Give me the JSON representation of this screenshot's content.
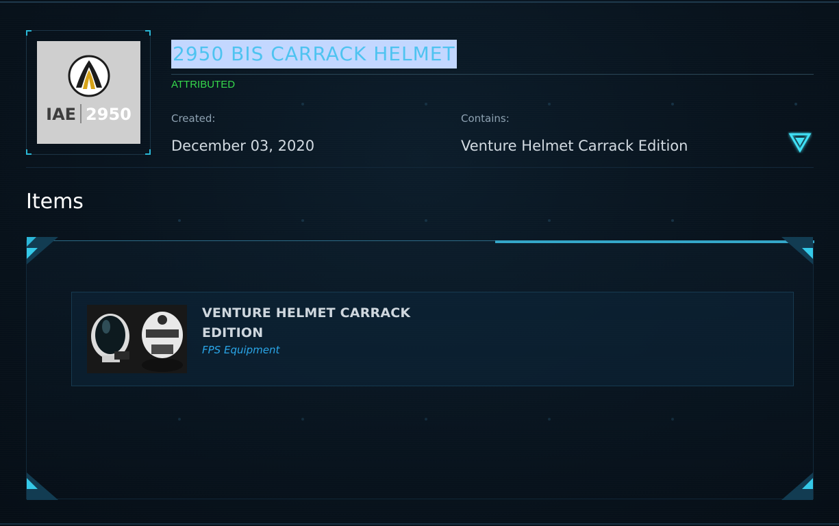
{
  "pledge": {
    "title": "2950 BIS CARRACK HELMET",
    "status": "ATTRIBUTED",
    "thumbnail": {
      "logo_text": "IAE",
      "logo_year": "2950",
      "icon": "iae-emblem-icon"
    },
    "created_label": "Created:",
    "created_value": "December 03, 2020",
    "contains_label": "Contains:",
    "contains_value": "Venture Helmet Carrack Edition",
    "expand_icon": "chevron-down-triangle-icon"
  },
  "items_section": {
    "heading": "Items",
    "items": [
      {
        "name": "VENTURE HELMET CARRACK EDITION",
        "type": "FPS Equipment",
        "icon": "helmet-image"
      }
    ]
  },
  "colors": {
    "accent": "#34a6c8",
    "status": "#36d94c",
    "title_highlight": "#c3d7ff",
    "title_text": "#4ec3f0",
    "item_type": "#2aa6e8",
    "background": "#08121c"
  }
}
